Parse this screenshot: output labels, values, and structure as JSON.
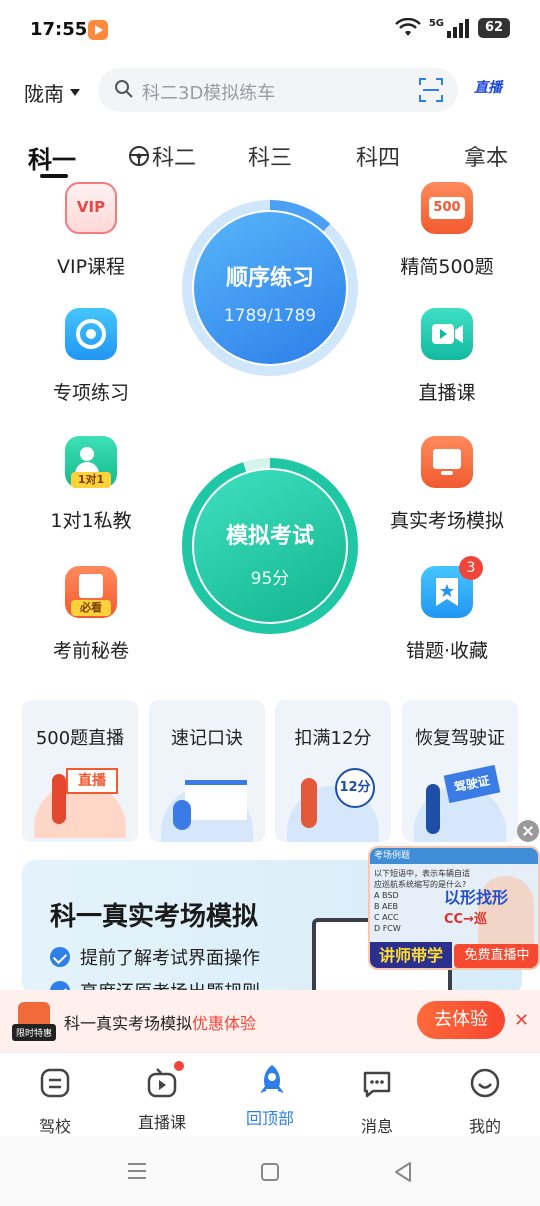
{
  "status": {
    "time": "17:55",
    "battery": "62",
    "network": "5G"
  },
  "header": {
    "city": "陇南",
    "search_placeholder": "科二3D模拟练车",
    "live_logo": "直播"
  },
  "tabs": [
    "科一",
    "科二",
    "科三",
    "科四",
    "拿本"
  ],
  "left_items": [
    {
      "label": "VIP课程",
      "icon": "vip-icon"
    },
    {
      "label": "专项练习",
      "icon": "target-icon"
    },
    {
      "label": "1对1私教",
      "icon": "tutor-icon",
      "tag": "1对1"
    },
    {
      "label": "考前秘卷",
      "icon": "exam-paper-icon",
      "tag": "必看"
    }
  ],
  "right_items": [
    {
      "label": "精简500题",
      "icon": "500-icon",
      "tag": "500"
    },
    {
      "label": "直播课",
      "icon": "video-icon"
    },
    {
      "label": "真实考场模拟",
      "icon": "monitor-icon"
    },
    {
      "label": "错题·收藏",
      "icon": "bookmark-icon",
      "badge": "3"
    }
  ],
  "practice": {
    "title": "顺序练习",
    "progress": "1789/1789",
    "fraction": 0.12
  },
  "mock": {
    "title": "模拟考试",
    "score": "95分",
    "fraction": 0.95
  },
  "cards": [
    "500题直播",
    "速记口诀",
    "扣满12分",
    "恢复驾驶证"
  ],
  "card_art_text": {
    "live": "直播",
    "points": "12分",
    "license": "驾驶证"
  },
  "promo": {
    "title": "科一真实考场模拟",
    "points": [
      "提前了解考试界面操作",
      "高度还原考场出题规则"
    ]
  },
  "video_ad": {
    "header": "考场例题",
    "question": "以下短语中，表示车辆自适应巡航系统缩写的是什么?",
    "options": [
      "A  BSD",
      "B  AEB",
      "C  ACC",
      "D  FCW"
    ],
    "topic": "以形找形",
    "topic2": "CC→巡",
    "badge_left": "讲师带学",
    "badge_right": "免费直播中"
  },
  "notice": {
    "tag": "限时特惠",
    "text": "科一真实考场模拟",
    "highlight": "优惠体验",
    "button": "去体验"
  },
  "bottom_nav": [
    "驾校",
    "直播课",
    "回顶部",
    "消息",
    "我的"
  ],
  "colors": {
    "accent": "#2f7fe8",
    "mock": "#1fc7a4",
    "alert": "#f0453a"
  }
}
